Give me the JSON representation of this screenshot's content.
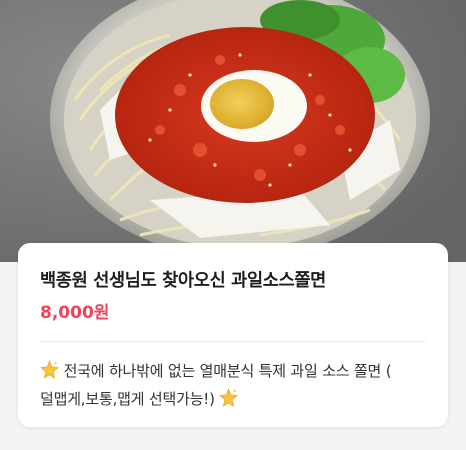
{
  "menu_item": {
    "title": "백종원 선생님도 찾아오신 과일소스쫄면",
    "price": "8,000원",
    "description_line1": "전국에 하나밖에 없는 열매분식 특제 과일 소스 쫄면 (",
    "description_line2": "덜맵게,보통,맵게 선택가능!)",
    "image": "cold-spicy-chewy-noodles-photo",
    "accent_color": "#f1435a",
    "decor_icon": "sparkle-star-icon"
  }
}
